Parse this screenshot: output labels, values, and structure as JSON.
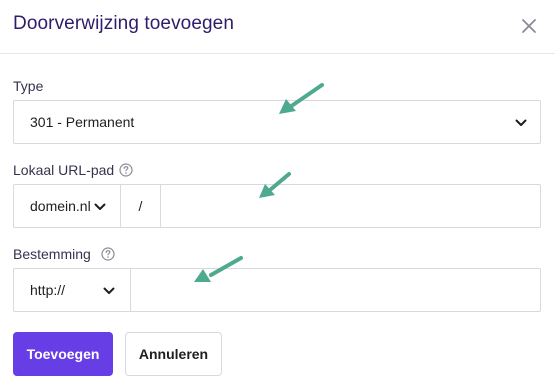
{
  "dialog": {
    "title": "Doorverwijzing toevoegen"
  },
  "type_field": {
    "label": "Type",
    "value": "301 - Permanent"
  },
  "local_path_field": {
    "label": "Lokaal URL-pad",
    "domain_value": "domein.nl",
    "separator": "/",
    "path_value": ""
  },
  "destination_field": {
    "label": "Bestemming",
    "protocol_value": "http://",
    "url_value": ""
  },
  "buttons": {
    "add": "Toevoegen",
    "cancel": "Annuleren"
  },
  "colors": {
    "primary": "#673de6",
    "annotation_arrow": "#4fa98f"
  }
}
